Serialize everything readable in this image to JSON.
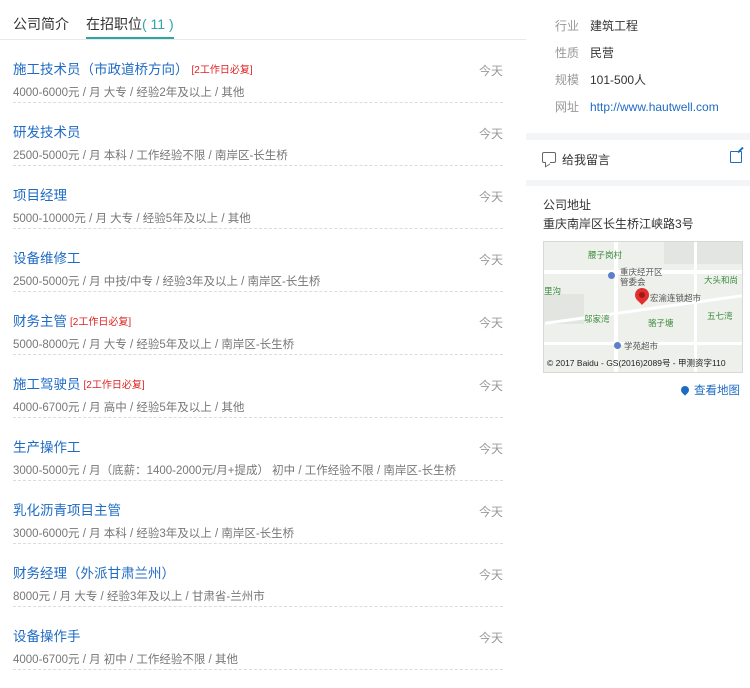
{
  "tabs": [
    {
      "label": "公司简介"
    },
    {
      "label": "在招职位",
      "count": "( 11 )"
    }
  ],
  "jobs": [
    {
      "title": "施工技术员（市政道桥方向）",
      "tag": "[2工作日必复]",
      "date": "今天",
      "meta": "4000-6000元 / 月    大专 / 经验2年及以上 / 其他"
    },
    {
      "title": "研发技术员",
      "tag": "",
      "date": "今天",
      "meta": "2500-5000元 / 月    本科 / 工作经验不限 / 南岸区-长生桥"
    },
    {
      "title": "项目经理",
      "tag": "",
      "date": "今天",
      "meta": "5000-10000元 / 月    大专 / 经验5年及以上 / 其他"
    },
    {
      "title": "设备维修工",
      "tag": "",
      "date": "今天",
      "meta": "2500-5000元 / 月    中技/中专 / 经验3年及以上 / 南岸区-长生桥"
    },
    {
      "title": "财务主管",
      "tag": "[2工作日必复]",
      "date": "今天",
      "meta": "5000-8000元 / 月    大专 / 经验5年及以上 / 南岸区-长生桥"
    },
    {
      "title": "施工驾驶员",
      "tag": "[2工作日必复]",
      "date": "今天",
      "meta": "4000-6700元 / 月    高中 / 经验5年及以上 / 其他"
    },
    {
      "title": "生产操作工",
      "tag": "",
      "date": "今天",
      "meta": "3000-5000元 / 月（底薪：1400-2000元/月+提成）   初中 / 工作经验不限 / 南岸区-长生桥"
    },
    {
      "title": "乳化沥青项目主管",
      "tag": "",
      "date": "今天",
      "meta": "3000-6000元 / 月    本科 / 经验3年及以上 / 南岸区-长生桥"
    },
    {
      "title": "财务经理（外派甘肃兰州）",
      "tag": "",
      "date": "今天",
      "meta": "8000元 / 月    大专 / 经验3年及以上 / 甘肃省-兰州市"
    },
    {
      "title": "设备操作手",
      "tag": "",
      "date": "今天",
      "meta": "4000-6700元 / 月    初中 / 工作经验不限 / 其他"
    }
  ],
  "company": {
    "industry_label": "行业",
    "industry": "建筑工程",
    "nature_label": "性质",
    "nature": "民营",
    "size_label": "规模",
    "size": "101-500人",
    "website_label": "网址",
    "website": "http://www.hautwell.com"
  },
  "message": {
    "label": "给我留言",
    "icon": "chat-icon",
    "edit_icon": "edit-icon"
  },
  "address": {
    "heading": "公司地址",
    "text": "重庆南岸区长生桥江峡路3号",
    "view_map": "查看地图"
  },
  "map": {
    "labels": [
      "腰子岗村",
      "重庆经开区",
      "管委会",
      "宏渝连锁超市",
      "大头和尚",
      "里沟",
      "邬家湾",
      "骆子塘",
      "五七湾",
      "学苑超市"
    ],
    "copyright": "© 2017 Baidu - GS(2016)2089号 - 甲测资字110"
  }
}
